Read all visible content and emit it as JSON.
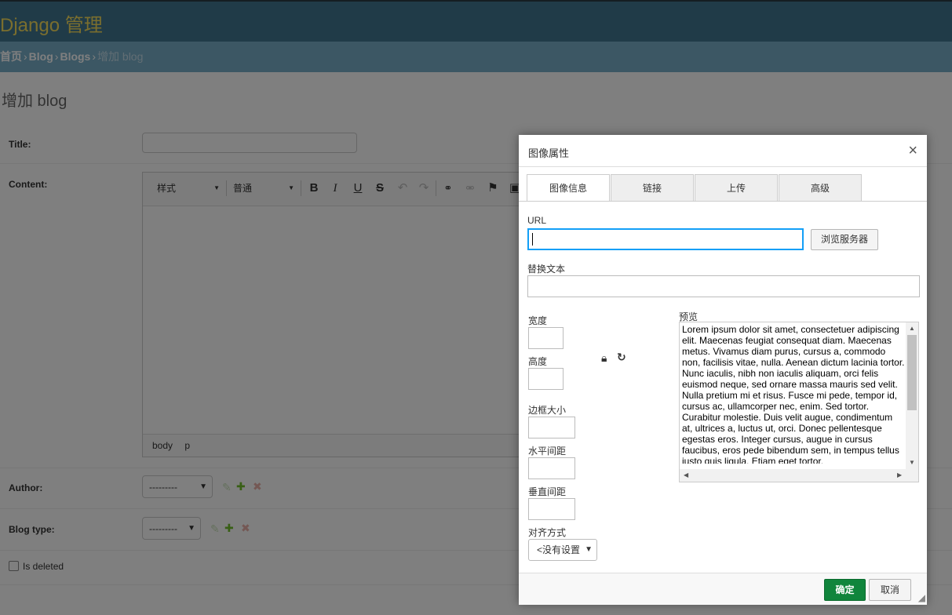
{
  "header": {
    "brand": "Django 管理"
  },
  "breadcrumbs": {
    "home": "首页",
    "app": "Blog",
    "model": "Blogs",
    "current": "增加 blog",
    "separator": "›"
  },
  "page_title": "增加 blog",
  "form": {
    "title_label": "Title:",
    "content_label": "Content:",
    "author_label": "Author:",
    "author_value": "---------",
    "blog_type_label": "Blog type:",
    "blog_type_value": "---------",
    "is_deleted_label": "Is deleted"
  },
  "editor": {
    "style_combo": "样式",
    "format_combo": "普通",
    "status_path": [
      "body",
      "p"
    ]
  },
  "dialog": {
    "title": "图像属性",
    "close": "×",
    "tabs": [
      "图像信息",
      "链接",
      "上传",
      "高级"
    ],
    "url_label": "URL",
    "url_value": "",
    "browse_button": "浏览服务器",
    "alt_label": "替换文本",
    "width_label": "宽度",
    "height_label": "高度",
    "border_label": "边框大小",
    "hspace_label": "水平间距",
    "vspace_label": "垂直间距",
    "align_label": "对齐方式",
    "align_value": "<没有设置",
    "preview_label": "预览",
    "preview_text": "Lorem ipsum dolor sit amet, consectetuer adipiscing elit. Maecenas feugiat consequat diam. Maecenas metus. Vivamus diam purus, cursus a, commodo non, facilisis vitae, nulla. Aenean dictum lacinia tortor. Nunc iaculis, nibh non iaculis aliquam, orci felis euismod neque, sed ornare massa mauris sed velit. Nulla pretium mi et risus. Fusce mi pede, tempor id, cursus ac, ullamcorper nec, enim. Sed tortor. Curabitur molestie. Duis velit augue, condimentum at, ultrices a, luctus ut, orci. Donec pellentesque egestas eros. Integer cursus, augue in cursus faucibus, eros pede bibendum sem, in tempus tellus justo quis ligula. Etiam eget tortor.",
    "ok_button": "确定",
    "cancel_button": "取消"
  }
}
